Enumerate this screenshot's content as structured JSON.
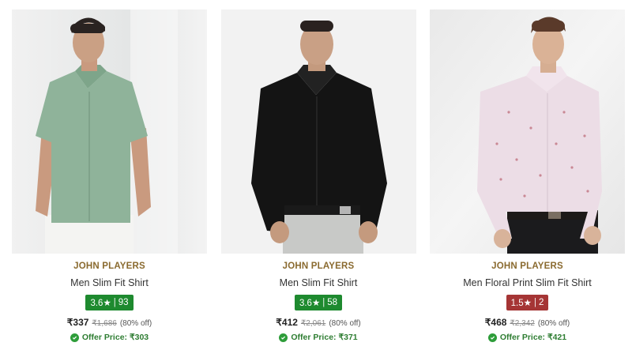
{
  "colors": {
    "brand": "#8a6a2f",
    "rating_good": "#1e8a2f",
    "rating_bad": "#a53535",
    "offer_green": "#2e9d3a"
  },
  "products": [
    {
      "brand": "JOHN PLAYERS",
      "title": "Men Slim Fit Shirt",
      "rating": "3.6★",
      "rating_count": "93",
      "rating_color": "#1e8a2f",
      "price": "₹337",
      "mrp": "₹1,686",
      "discount": "(80% off)",
      "offer": "Offer Price: ₹303",
      "image_icon": "product-image-green-shirt"
    },
    {
      "brand": "JOHN PLAYERS",
      "title": "Men Slim Fit Shirt",
      "rating": "3.6★",
      "rating_count": "58",
      "rating_color": "#1e8a2f",
      "price": "₹412",
      "mrp": "₹2,061",
      "discount": "(80% off)",
      "offer": "Offer Price: ₹371",
      "image_icon": "product-image-black-shirt"
    },
    {
      "brand": "JOHN PLAYERS",
      "title": "Men Floral Print Slim Fit Shirt",
      "rating": "1.5★",
      "rating_count": "2",
      "rating_color": "#a53535",
      "price": "₹468",
      "mrp": "₹2,342",
      "discount": "(80% off)",
      "offer": "Offer Price: ₹421",
      "image_icon": "product-image-floral-shirt"
    }
  ]
}
